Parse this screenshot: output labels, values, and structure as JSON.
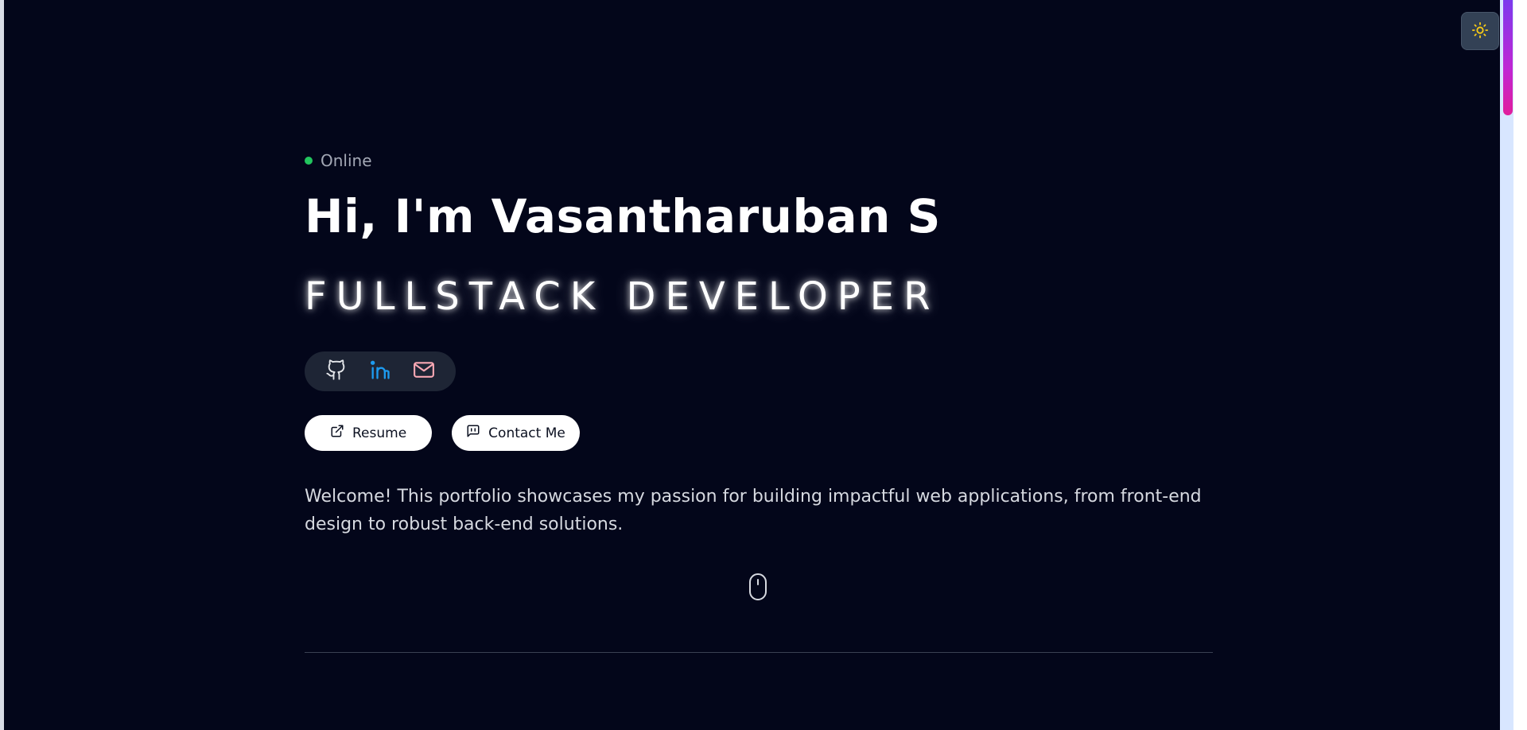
{
  "status": {
    "label": "Online",
    "dot_color": "#22c55e"
  },
  "hero": {
    "headline": "Hi, I'm Vasantharuban S",
    "role": "FULLSTACK DEVELOPER",
    "welcome": "Welcome! This portfolio showcases my passion for building impactful web applications, from front-end design to robust back-end solutions."
  },
  "social": {
    "items": [
      {
        "icon": "github-icon",
        "color": "#e5e7eb"
      },
      {
        "icon": "linkedin-icon",
        "color": "#1d9bf0"
      },
      {
        "icon": "mail-icon",
        "color": "#f9a8b4"
      }
    ]
  },
  "buttons": {
    "resume": "Resume",
    "contact": "Contact Me"
  },
  "theme_toggle": {
    "icon": "sun-icon",
    "color": "#facc15"
  },
  "colors": {
    "background": "#03061a",
    "accent_scrollbar": "#c026d3"
  }
}
